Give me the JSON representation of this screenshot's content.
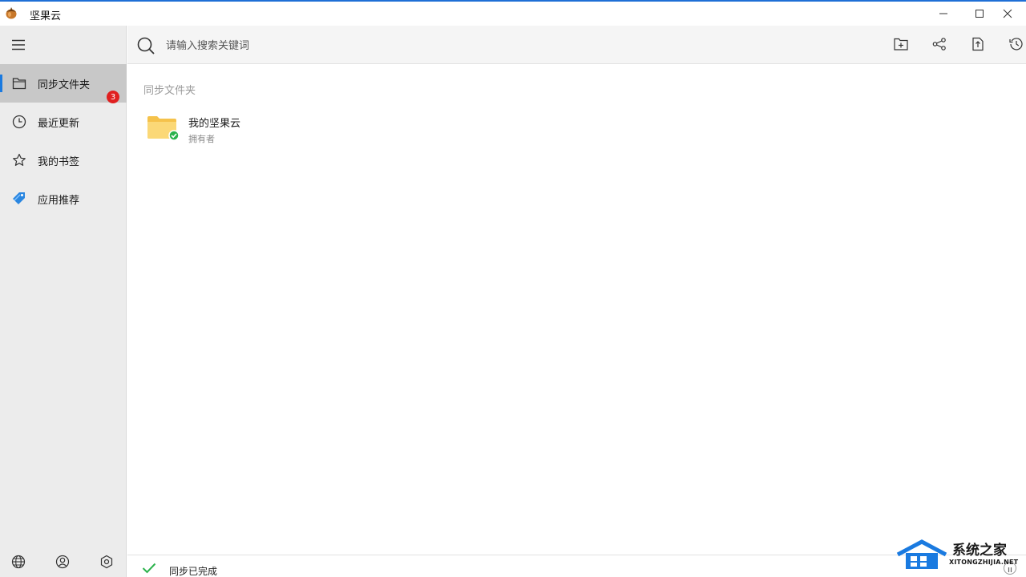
{
  "window": {
    "title": "坚果云",
    "controls": [
      "minimize-icon",
      "maximize-icon",
      "close-icon"
    ],
    "accent_color": "#1f6fd6"
  },
  "sidebar": {
    "menu_icon": "hamburger-icon",
    "items": [
      {
        "label": "同步文件夹",
        "icon": "folder-outline-icon",
        "active": true
      },
      {
        "label": "最近更新",
        "icon": "clock-icon",
        "badge": "3"
      },
      {
        "label": "我的书签",
        "icon": "star-icon"
      },
      {
        "label": "应用推荐",
        "icon": "tag-icon"
      }
    ],
    "bottom_icons": [
      "globe-icon",
      "account-icon",
      "settings-icon"
    ]
  },
  "search": {
    "placeholder": "请输入搜索关键词",
    "value": ""
  },
  "toolbar": {
    "icons": [
      "new-folder-icon",
      "share-icon",
      "upload-file-icon",
      "history-icon"
    ]
  },
  "content": {
    "section_title": "同步文件夹",
    "folders": [
      {
        "name": "我的坚果云",
        "role": "拥有者",
        "status": "synced"
      }
    ]
  },
  "status": {
    "text": "同步已完成",
    "icon": "check-icon",
    "color": "#2bb24c"
  },
  "watermark": {
    "name": "系统之家",
    "domain": "XITONGZHIJIA.NET"
  }
}
